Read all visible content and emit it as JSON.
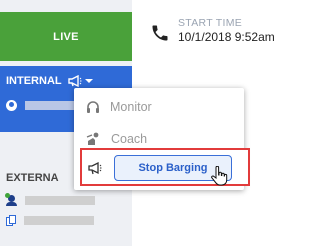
{
  "live_tab": {
    "label": "LIVE"
  },
  "internal": {
    "label": "INTERNAL",
    "icon": "megaphone-icon"
  },
  "external": {
    "label": "EXTERNA"
  },
  "start_time": {
    "label": "START TIME",
    "value": "10/1/2018 9:52am",
    "icon": "phone-icon"
  },
  "menu": {
    "items": [
      {
        "label": "Monitor",
        "icon": "headphones-icon"
      },
      {
        "label": "Coach",
        "icon": "coach-icon"
      }
    ],
    "barge": {
      "icon": "megaphone-icon",
      "button_label": "Stop Barging"
    }
  },
  "colors": {
    "live_green": "#4aa13a",
    "internal_blue": "#2f6ad7",
    "highlight_red": "#e23b3b",
    "button_blue": "#3a6fd8"
  }
}
